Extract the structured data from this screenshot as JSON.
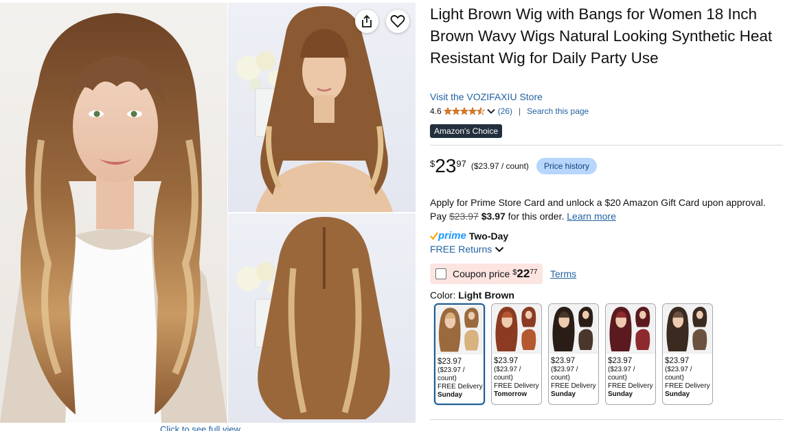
{
  "product": {
    "title": "Light Brown Wig with Bangs for Women 18 Inch Brown Wavy Wigs Natural Looking Synthetic Heat Resistant Wig for Daily Party Use",
    "store_link": "Visit the VOZIFAXIU Store",
    "rating": "4.6",
    "rating_stars": 4.5,
    "rating_count": "(26)",
    "search_page": "Search this page",
    "badge": "Amazon's Choice"
  },
  "price": {
    "symbol": "$",
    "whole": "23",
    "fraction": "97",
    "unit_price": "($23.97 / count)",
    "history_button": "Price history"
  },
  "promo": {
    "line1": "Apply for Prime Store Card and unlock a $20 Amazon Gift Card upon approval.",
    "pay_label": "Pay",
    "old_price": "$23.97",
    "new_price": "$3.97",
    "after": "for this order.",
    "learn_more": "Learn more"
  },
  "delivery": {
    "prime_word": "prime",
    "prime_speed": "Two-Day",
    "returns": "FREE Returns"
  },
  "coupon": {
    "label": "Coupon price",
    "symbol": "$",
    "whole": "22",
    "fraction": "77",
    "terms": "Terms"
  },
  "color": {
    "label": "Color:",
    "selected": "Light Brown",
    "options": [
      {
        "price": "$23.97",
        "unit": "($23.97 / count)",
        "delivery": "FREE Delivery",
        "when": "Sunday",
        "hair": "#9a6a3e",
        "hair2": "#d8b27f"
      },
      {
        "price": "$23.97",
        "unit": "($23.97 / count)",
        "delivery": "FREE Delivery",
        "when": "Tomorrow",
        "hair": "#8a3b22",
        "hair2": "#b3582f"
      },
      {
        "price": "$23.97",
        "unit": "($23.97 / count)",
        "delivery": "FREE Delivery",
        "when": "Sunday",
        "hair": "#2a1d17",
        "hair2": "#4a362b"
      },
      {
        "price": "$23.97",
        "unit": "($23.97 / count)",
        "delivery": "FREE Delivery",
        "when": "Sunday",
        "hair": "#5a1a1e",
        "hair2": "#8d2a2f"
      },
      {
        "price": "$23.97",
        "unit": "($23.97 / count)",
        "delivery": "FREE Delivery",
        "when": "Sunday",
        "hair": "#3a2a20",
        "hair2": "#6b5240"
      }
    ]
  },
  "gallery": {
    "full_view": "Click to see full view"
  },
  "colors": {
    "link": "#2162a1",
    "badge_bg": "#232f3e",
    "prime": "#1a98ff",
    "coupon_bg": "#fce4e1",
    "price_history_bg": "#b7d6fb"
  },
  "icons": [
    "share-icon",
    "heart-icon",
    "star-icon",
    "chevron-down-icon",
    "prime-check-icon",
    "checkbox"
  ]
}
